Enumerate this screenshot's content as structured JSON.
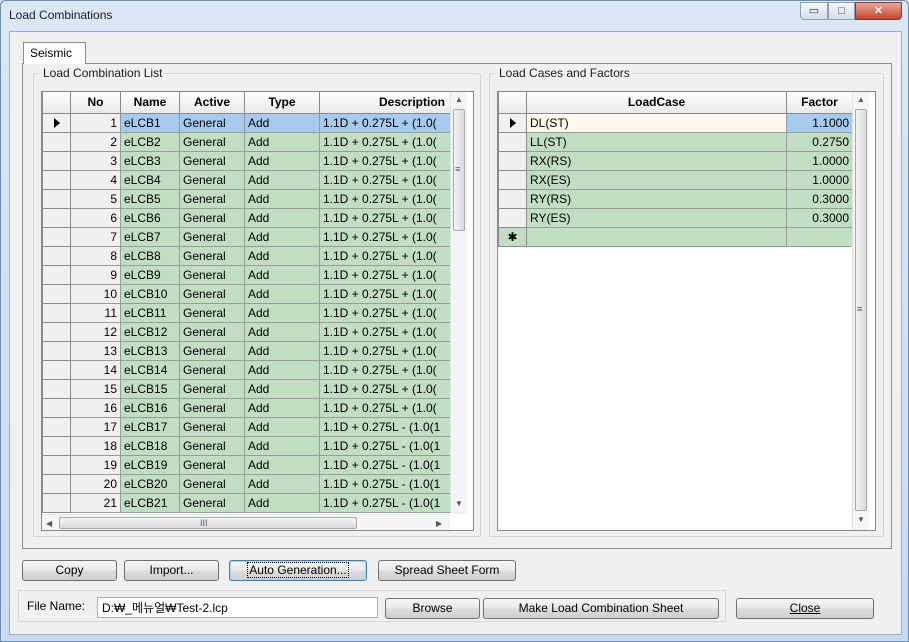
{
  "window": {
    "title": "Load Combinations",
    "min_label": "▭",
    "max_label": "□",
    "close_label": "✕"
  },
  "tabs": [
    {
      "label": "Seismic"
    }
  ],
  "left_group": {
    "title": "Load Combination List",
    "columns": [
      "No",
      "Name",
      "Active",
      "Type",
      "Description"
    ],
    "rows": [
      {
        "no": "1",
        "name": "eLCB1",
        "active": "General",
        "type": "Add",
        "desc": "1.1D + 0.275L + (1.0("
      },
      {
        "no": "2",
        "name": "eLCB2",
        "active": "General",
        "type": "Add",
        "desc": "1.1D + 0.275L + (1.0("
      },
      {
        "no": "3",
        "name": "eLCB3",
        "active": "General",
        "type": "Add",
        "desc": "1.1D + 0.275L + (1.0("
      },
      {
        "no": "4",
        "name": "eLCB4",
        "active": "General",
        "type": "Add",
        "desc": "1.1D + 0.275L + (1.0("
      },
      {
        "no": "5",
        "name": "eLCB5",
        "active": "General",
        "type": "Add",
        "desc": "1.1D + 0.275L + (1.0("
      },
      {
        "no": "6",
        "name": "eLCB6",
        "active": "General",
        "type": "Add",
        "desc": "1.1D + 0.275L + (1.0("
      },
      {
        "no": "7",
        "name": "eLCB7",
        "active": "General",
        "type": "Add",
        "desc": "1.1D + 0.275L + (1.0("
      },
      {
        "no": "8",
        "name": "eLCB8",
        "active": "General",
        "type": "Add",
        "desc": "1.1D + 0.275L + (1.0("
      },
      {
        "no": "9",
        "name": "eLCB9",
        "active": "General",
        "type": "Add",
        "desc": "1.1D + 0.275L + (1.0("
      },
      {
        "no": "10",
        "name": "eLCB10",
        "active": "General",
        "type": "Add",
        "desc": "1.1D + 0.275L + (1.0("
      },
      {
        "no": "11",
        "name": "eLCB11",
        "active": "General",
        "type": "Add",
        "desc": "1.1D + 0.275L + (1.0("
      },
      {
        "no": "12",
        "name": "eLCB12",
        "active": "General",
        "type": "Add",
        "desc": "1.1D + 0.275L + (1.0("
      },
      {
        "no": "13",
        "name": "eLCB13",
        "active": "General",
        "type": "Add",
        "desc": "1.1D + 0.275L + (1.0("
      },
      {
        "no": "14",
        "name": "eLCB14",
        "active": "General",
        "type": "Add",
        "desc": "1.1D + 0.275L + (1.0("
      },
      {
        "no": "15",
        "name": "eLCB15",
        "active": "General",
        "type": "Add",
        "desc": "1.1D + 0.275L + (1.0("
      },
      {
        "no": "16",
        "name": "eLCB16",
        "active": "General",
        "type": "Add",
        "desc": "1.1D + 0.275L + (1.0("
      },
      {
        "no": "17",
        "name": "eLCB17",
        "active": "General",
        "type": "Add",
        "desc": "1.1D + 0.275L - (1.0(1"
      },
      {
        "no": "18",
        "name": "eLCB18",
        "active": "General",
        "type": "Add",
        "desc": "1.1D + 0.275L - (1.0(1"
      },
      {
        "no": "19",
        "name": "eLCB19",
        "active": "General",
        "type": "Add",
        "desc": "1.1D + 0.275L - (1.0(1"
      },
      {
        "no": "20",
        "name": "eLCB20",
        "active": "General",
        "type": "Add",
        "desc": "1.1D + 0.275L - (1.0(1"
      },
      {
        "no": "21",
        "name": "eLCB21",
        "active": "General",
        "type": "Add",
        "desc": "1.1D + 0.275L - (1.0(1"
      }
    ]
  },
  "right_group": {
    "title": "Load Cases and Factors",
    "columns": [
      "LoadCase",
      "Factor"
    ],
    "rows": [
      {
        "loadcase": "DL(ST)",
        "factor": "1.1000"
      },
      {
        "loadcase": "LL(ST)",
        "factor": "0.2750"
      },
      {
        "loadcase": "RX(RS)",
        "factor": "1.0000"
      },
      {
        "loadcase": "RX(ES)",
        "factor": "1.0000"
      },
      {
        "loadcase": "RY(RS)",
        "factor": "0.3000"
      },
      {
        "loadcase": "RY(ES)",
        "factor": "0.3000"
      }
    ],
    "new_row_marker": "✱"
  },
  "buttons": {
    "copy": "Copy",
    "import": "Import...",
    "auto_generation": "Auto Generation...",
    "spreadsheet": "Spread Sheet Form",
    "browse": "Browse",
    "make_sheet": "Make Load Combination Sheet",
    "close": "Close"
  },
  "file": {
    "label": "File Name:",
    "value": "D:₩_메뉴얼₩Test-2.lcp"
  },
  "scroll_glyphs": {
    "up": "▲",
    "down": "▼",
    "left": "◀",
    "right": "▶",
    "grip_v": "≡",
    "grip_h": "III"
  },
  "colors": {
    "row_green": "#c1dec3",
    "selected_blue": "#a6cbef",
    "title_bar": "#dbe8f6"
  }
}
